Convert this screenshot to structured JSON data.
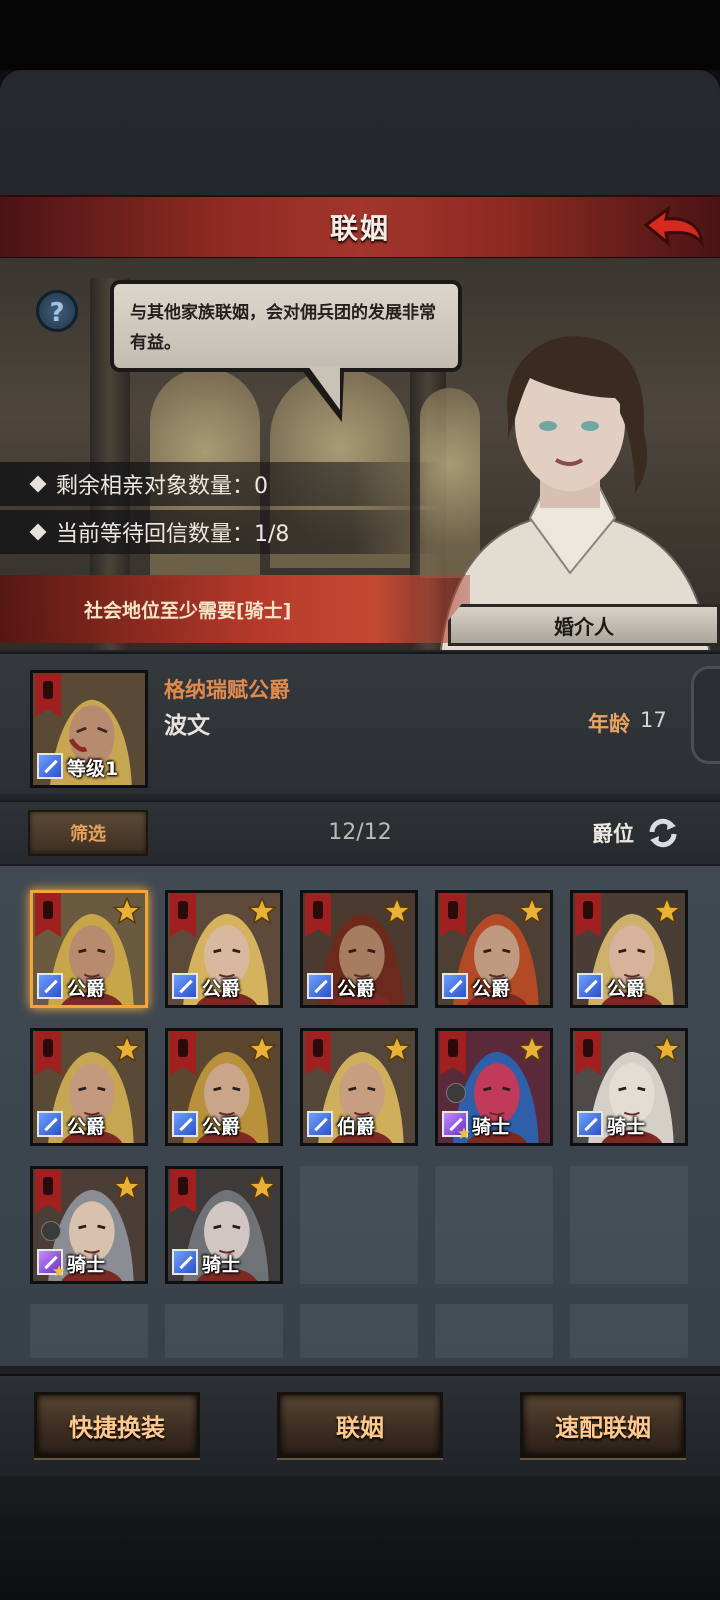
{
  "header": {
    "title": "联姻"
  },
  "npc": {
    "speech": "与其他家族联姻，会对佣兵团的发展非常有益。",
    "role_label": "婚介人"
  },
  "info": {
    "remaining_label": "剩余相亲对象数量：0",
    "waiting_label": "当前等待回信数量：1/8",
    "requirement": "社会地位至少需要[骑士]"
  },
  "selected": {
    "title": "格纳瑞赋公爵",
    "name": "波文",
    "age_label": "年龄",
    "age": "17",
    "level_label": "等级1"
  },
  "filter": {
    "button": "筛选",
    "count": "12/12",
    "sort_label": "爵位"
  },
  "candidates": [
    {
      "rank": "公爵",
      "class": "sword-icon",
      "hair": "#c9a54a",
      "skin": "#b88a6e",
      "bg": "#6a5a3f"
    },
    {
      "rank": "公爵",
      "class": "sword-icon",
      "hair": "#d4b25e",
      "skin": "#d9b8a0",
      "bg": "#5e4a3a"
    },
    {
      "rank": "公爵",
      "class": "sword-icon",
      "hair": "#6b2a1c",
      "skin": "#a77d62",
      "bg": "#4b3a30"
    },
    {
      "rank": "公爵",
      "class": "sword-icon",
      "hair": "#b24a26",
      "skin": "#c09a80",
      "bg": "#4e3f34"
    },
    {
      "rank": "公爵",
      "class": "sword-icon",
      "hair": "#cdb06a",
      "skin": "#d6b39a",
      "bg": "#4a3d35"
    },
    {
      "rank": "公爵",
      "class": "sword-icon",
      "hair": "#c7a651",
      "skin": "#c49a7e",
      "bg": "#5a4a35"
    },
    {
      "rank": "公爵",
      "class": "sword-icon",
      "hair": "#b8913a",
      "skin": "#c9a58a",
      "bg": "#5b4630"
    },
    {
      "rank": "伯爵",
      "class": "sword-icon",
      "hair": "#cfae5c",
      "skin": "#c79e80",
      "bg": "#54473a"
    },
    {
      "rank": "骑士",
      "class": "staff-icon",
      "hair": "#2f5fa8",
      "skin": "#c23a5a",
      "bg": "#5a2a3a"
    },
    {
      "rank": "骑士",
      "class": "sword-icon",
      "hair": "#d4d0c8",
      "skin": "#e4ddd4",
      "bg": "#4e4a48"
    },
    {
      "rank": "骑士",
      "class": "staff-icon",
      "hair": "#8a8e94",
      "skin": "#d8c2ae",
      "bg": "#4a3e36"
    },
    {
      "rank": "骑士",
      "class": "sword-icon",
      "hair": "#6f7276",
      "skin": "#d2c6c2",
      "bg": "#3e3a3a"
    }
  ],
  "buttons": {
    "quick_equip": "快捷换装",
    "marriage": "联姻",
    "quick_match": "速配联姻"
  },
  "colors": {
    "accent_orange": "#e08a4e",
    "header_red": "#a3352c",
    "star_gold": "#e9b237",
    "selected_border": "#f2a53a"
  }
}
